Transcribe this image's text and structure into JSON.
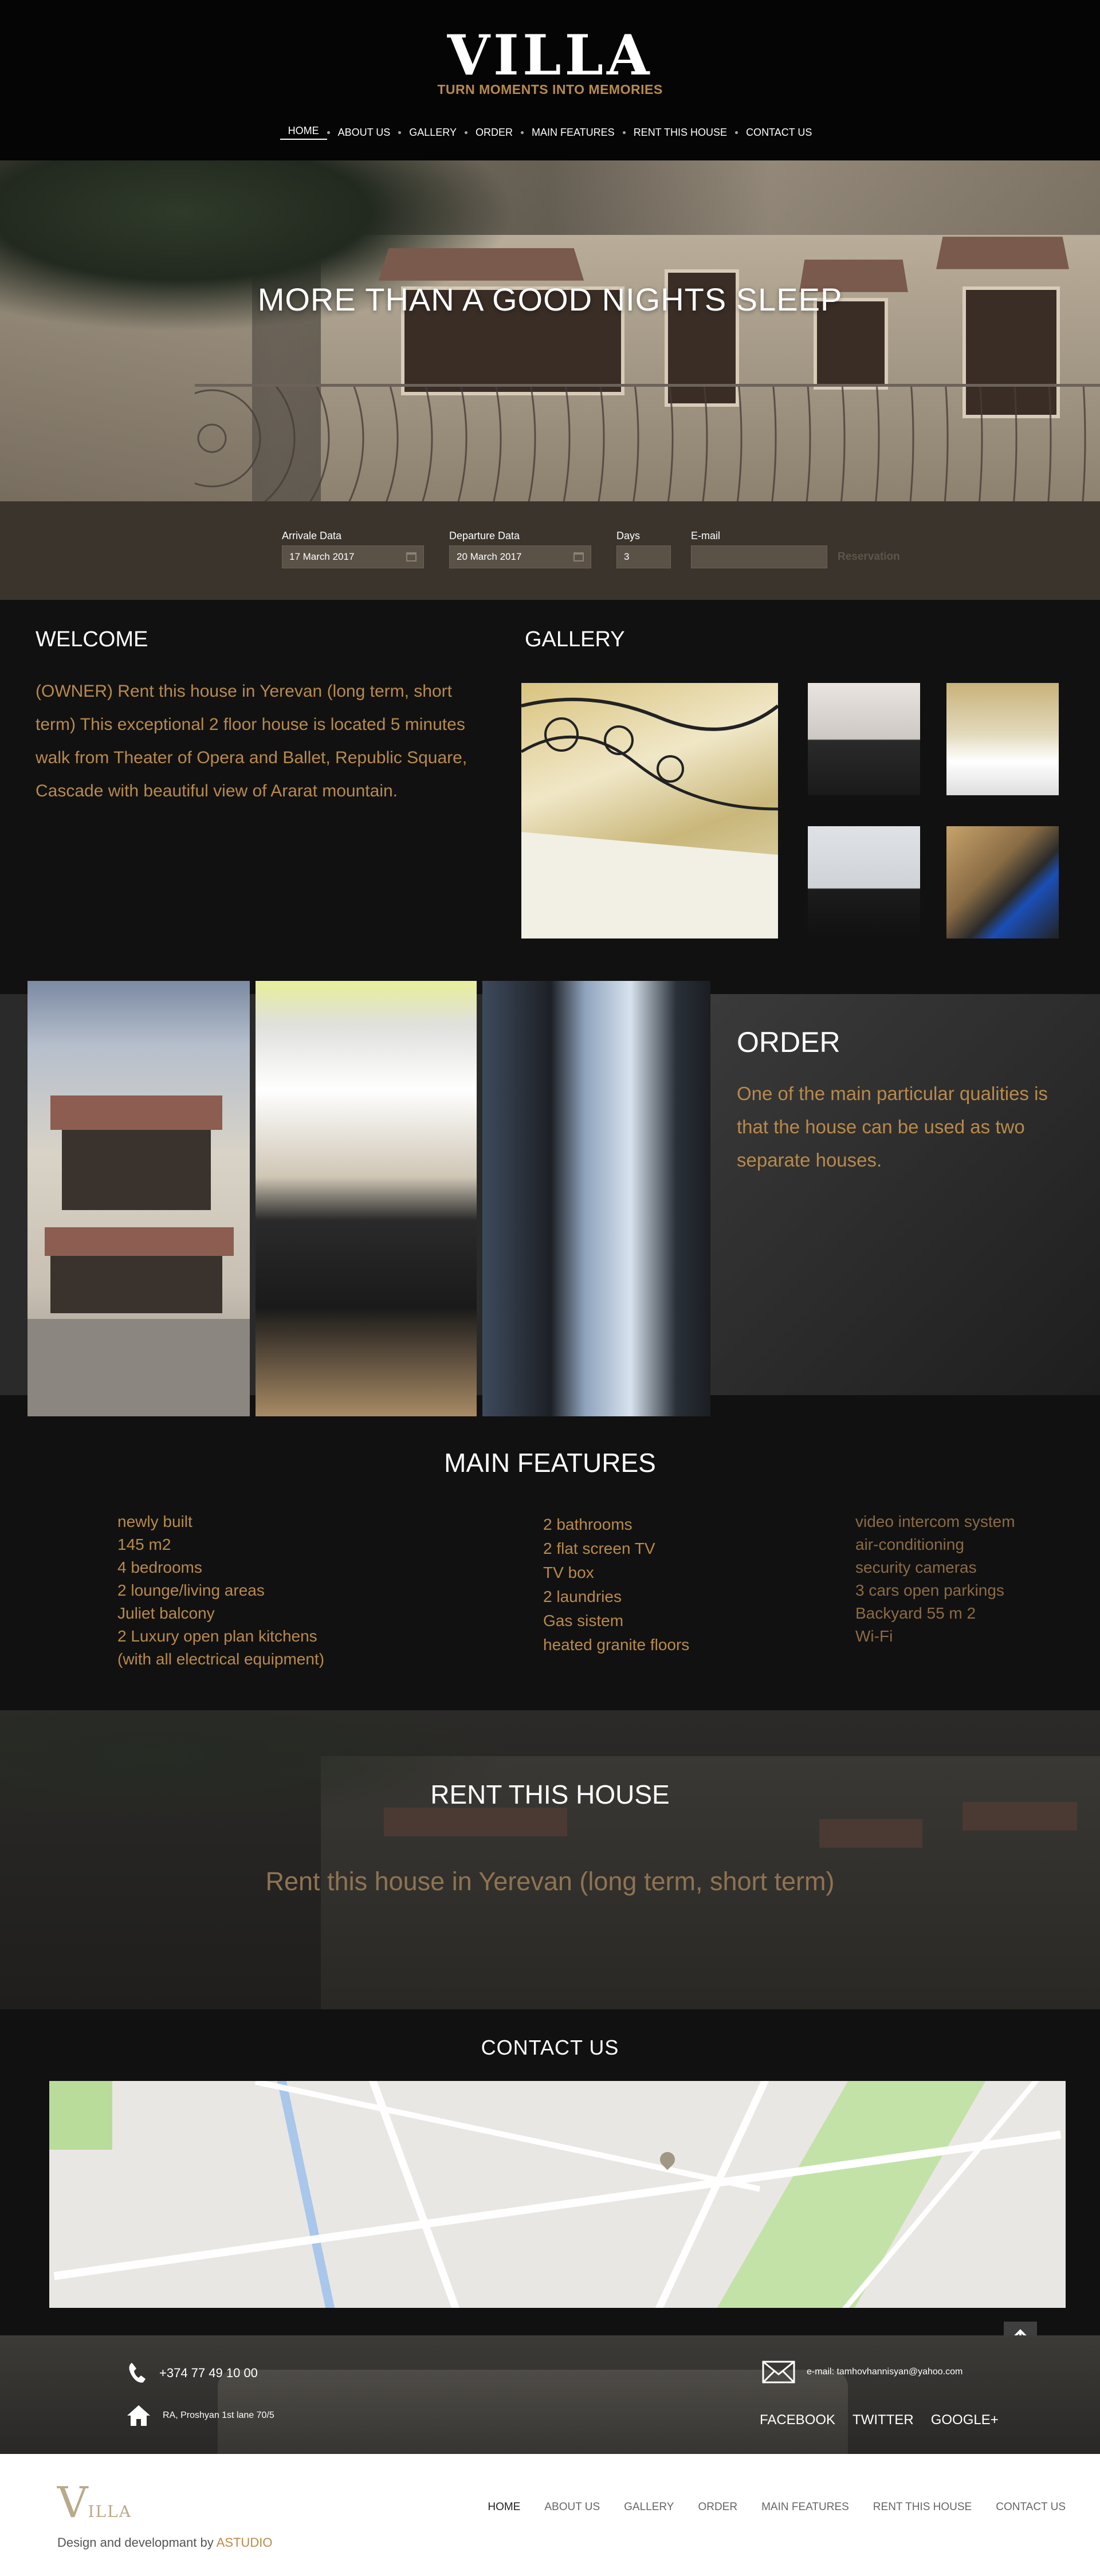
{
  "header": {
    "logo": "VILLA",
    "tagline": "TURN MOMENTS INTO MEMORIES",
    "nav": [
      "HOME",
      "ABOUT US",
      "GALLERY",
      "ORDER",
      "MAIN FEATURES",
      "RENT THIS HOUSE",
      "CONTACT US"
    ]
  },
  "hero": {
    "title": "MORE THAN A GOOD NIGHTS SLEEP"
  },
  "booking": {
    "arrival_label": "Arrivale Data",
    "arrival_value": "17 March 2017",
    "departure_label": "Departure Data",
    "departure_value": "20 March 2017",
    "days_label": "Days",
    "days_value": "3",
    "email_label": "E-mail",
    "email_value": "",
    "reserve_label": "Reservation"
  },
  "welcome": {
    "title": "WELCOME",
    "text": "(OWNER)  Rent this house in Yerevan   (long term, short term) This exceptional 2 floor house is located 5 minutes walk from Theater of  Opera and Ballet, Republic  Square, Cascade  with beautiful view of Ararat mountain."
  },
  "gallery": {
    "title": "GALLERY"
  },
  "order": {
    "title": "ORDER",
    "text": "One of the main particular qualities is that the house can be used as two separate houses."
  },
  "features": {
    "title": "MAIN FEATURES",
    "col1": [
      "newly built",
      "145 m2",
      "4 bedrooms",
      "2  lounge/living areas",
      "Juliet balcony",
      "2 Luxury open plan kitchens",
      "(with all electrical equipment)"
    ],
    "col2": [
      "2 bathrooms",
      "2  flat screen TV",
      "TV box",
      "2 laundries",
      "Gas sistem",
      "heated granite floors"
    ],
    "col3": [
      "video intercom system",
      "air-conditioning",
      " security cameras",
      "3 cars open parkings",
      "Backyard  55 m 2",
      "Wi-Fi"
    ]
  },
  "rent": {
    "title": "RENT THIS HOUSE",
    "subtitle": "Rent this house in Yerevan (long term, short term)"
  },
  "contact": {
    "title": "CONTACT  US",
    "phone": "+374 77 49 10 00",
    "address": "RA, Proshyan 1st lane  70/5",
    "email": "e-mail: tamhovhannisyan@yahoo.com",
    "social": [
      "FACEBOOK",
      "TWITTER",
      "GOOGLE+"
    ]
  },
  "footer": {
    "logo": "V",
    "logo_rest": "ILLA",
    "credit": "Design and developmant by ",
    "studio": "ASTUDIO",
    "nav": [
      "HOME",
      "ABOUT US",
      "GALLERY",
      "ORDER",
      "MAIN FEATURES",
      "RENT THIS HOUSE",
      "CONTACT US"
    ]
  },
  "icons": {
    "phone": "phone-icon",
    "home": "home-icon",
    "mail": "mail-icon",
    "up": "arrow-up-icon",
    "calendar": "calendar-icon"
  },
  "colors": {
    "accent": "#b98a4a",
    "background": "#111111"
  }
}
